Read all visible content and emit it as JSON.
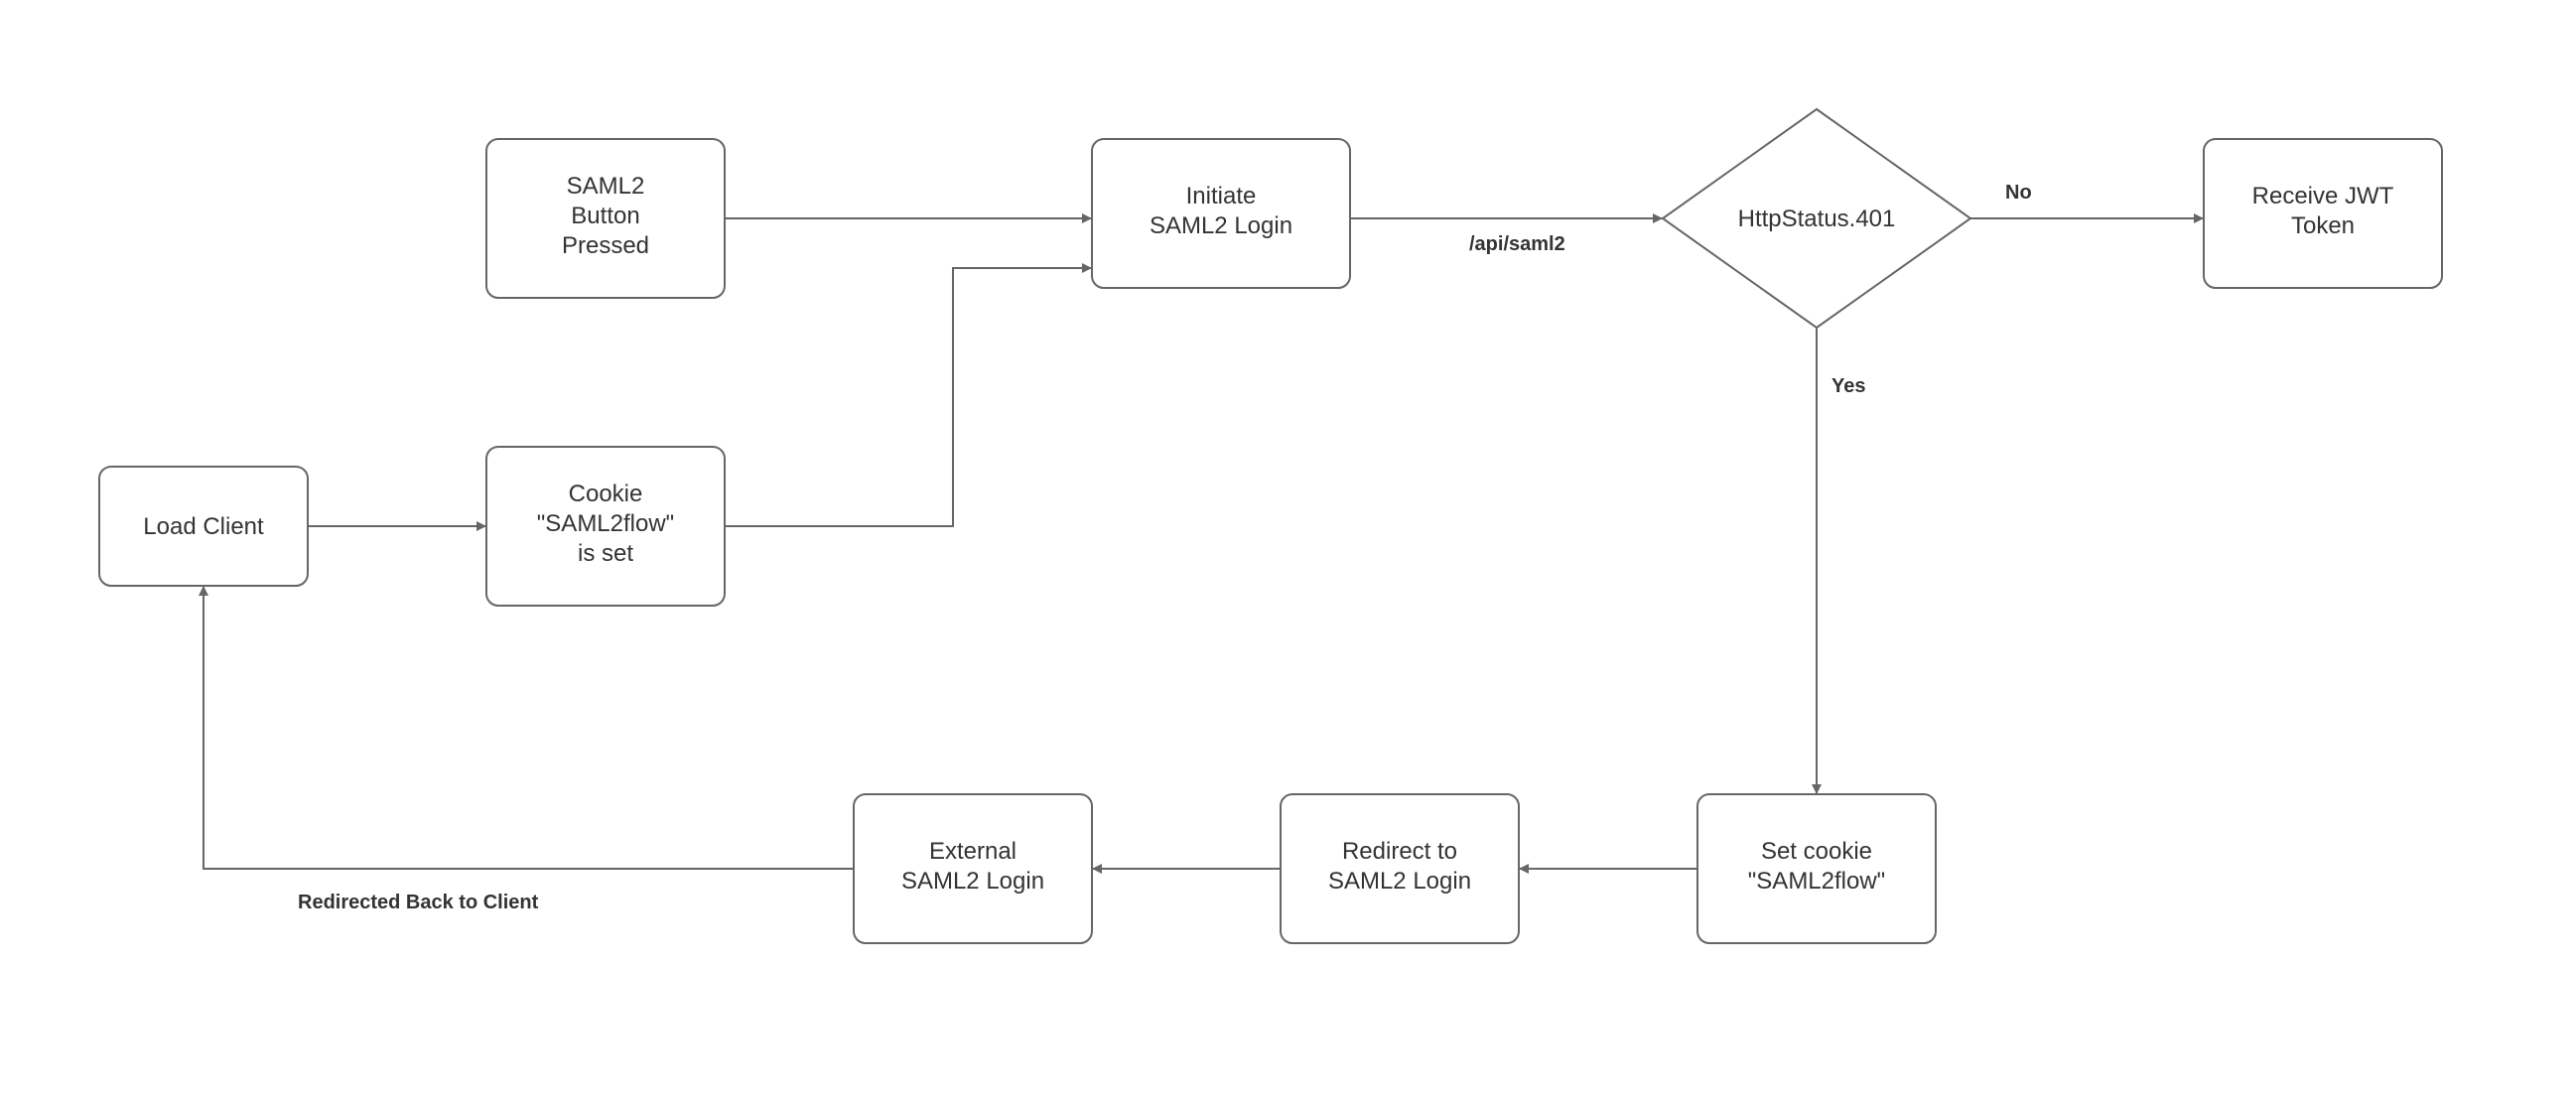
{
  "nodes": {
    "load_client": {
      "lines": [
        "Load Client"
      ]
    },
    "cookie_isset": {
      "lines": [
        "Cookie",
        "\"SAML2flow\"",
        "is set"
      ]
    },
    "saml_button": {
      "lines": [
        "SAML2",
        "Button",
        "Pressed"
      ]
    },
    "initiate": {
      "lines": [
        "Initiate",
        "SAML2 Login"
      ]
    },
    "decision": {
      "lines": [
        "HttpStatus.401"
      ]
    },
    "receive_jwt": {
      "lines": [
        "Receive JWT",
        "Token"
      ]
    },
    "set_cookie": {
      "lines": [
        "Set cookie",
        "\"SAML2flow\""
      ]
    },
    "redirect": {
      "lines": [
        "Redirect to",
        "SAML2 Login"
      ]
    },
    "external": {
      "lines": [
        "External",
        "SAML2 Login"
      ]
    }
  },
  "edges": {
    "api_saml2": "/api/saml2",
    "no": "No",
    "yes": "Yes",
    "redirected": "Redirected Back to Client"
  }
}
